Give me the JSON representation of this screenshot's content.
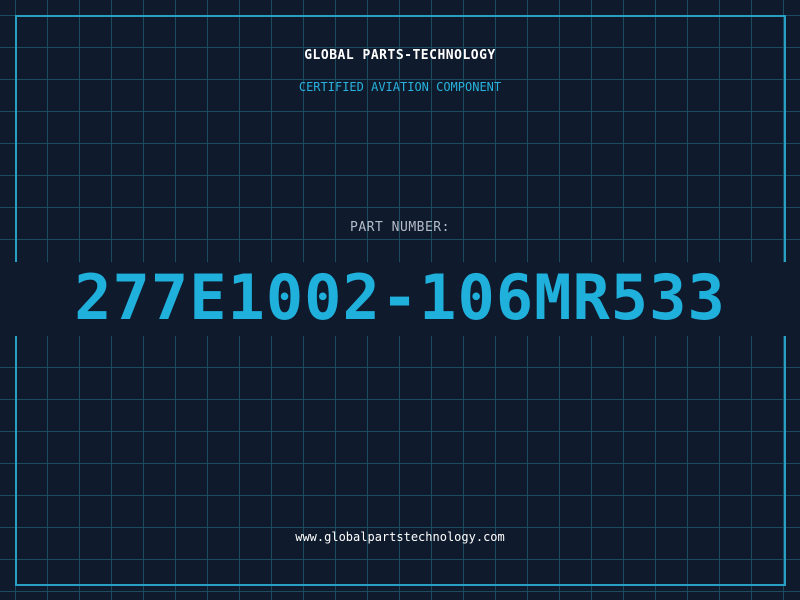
{
  "header": {
    "brand": "GLOBAL PARTS-TECHNOLOGY",
    "tagline": "CERTIFIED AVIATION COMPONENT"
  },
  "part": {
    "label": "PART NUMBER:",
    "number": "277E1002-106MR533"
  },
  "footer": {
    "url": "www.globalpartstechnology.com"
  },
  "colors": {
    "background": "#0f1a2d",
    "grid": "#1c4a5f",
    "frame": "#2a9fc4",
    "accent": "#1fb0dc",
    "text": "#ffffff",
    "label": "#b4bcc8"
  }
}
